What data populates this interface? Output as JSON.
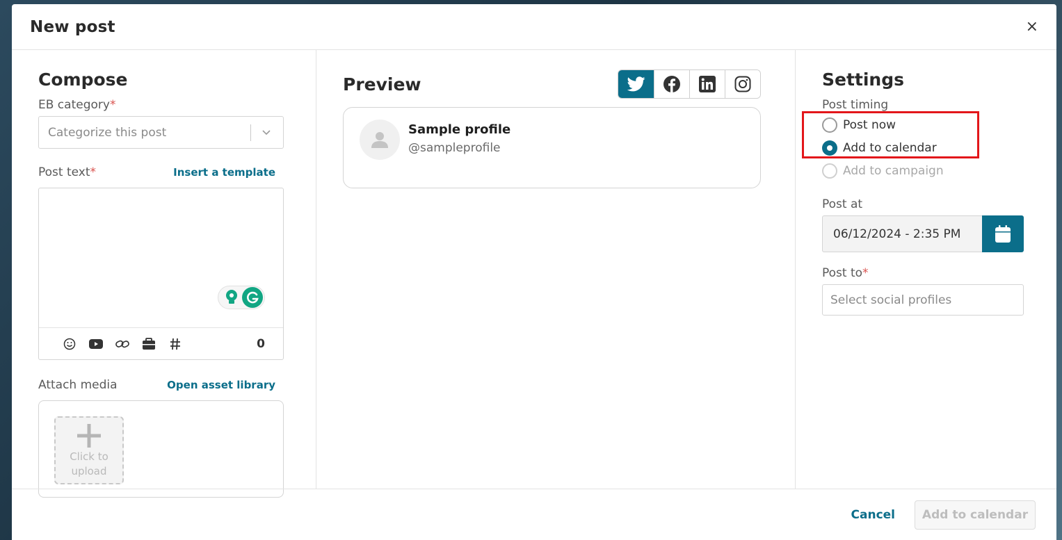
{
  "modal": {
    "title": "New post",
    "close_label": "×"
  },
  "compose": {
    "title": "Compose",
    "category_label": "EB category",
    "category_placeholder": "Categorize this post",
    "post_text_label": "Post text",
    "insert_template": "Insert a template",
    "char_count": "0",
    "toolbar_icons": [
      "emoji-icon",
      "youtube-icon",
      "link-icon",
      "briefcase-icon",
      "hashtag-icon"
    ],
    "attach_media_label": "Attach media",
    "open_asset_library": "Open asset library",
    "upload_line1": "Click to",
    "upload_line2": "upload"
  },
  "preview": {
    "title": "Preview",
    "networks": [
      {
        "name": "twitter",
        "active": true
      },
      {
        "name": "facebook",
        "active": false
      },
      {
        "name": "linkedin",
        "active": false
      },
      {
        "name": "instagram",
        "active": false
      }
    ],
    "profile_name": "Sample profile",
    "profile_handle": "@sampleprofile"
  },
  "settings": {
    "title": "Settings",
    "post_timing_label": "Post timing",
    "timing_options": [
      {
        "label": "Post now",
        "checked": false,
        "disabled": false
      },
      {
        "label": "Add to calendar",
        "checked": true,
        "disabled": false
      },
      {
        "label": "Add to campaign",
        "checked": false,
        "disabled": true
      }
    ],
    "post_at_label": "Post at",
    "post_at_value": "06/12/2024 - 2:35 PM",
    "post_to_label": "Post to",
    "post_to_placeholder": "Select social profiles"
  },
  "footer": {
    "cancel": "Cancel",
    "submit": "Add to calendar"
  },
  "colors": {
    "accent": "#0b6e8a",
    "required": "#d9534f",
    "highlight": "#e3161a"
  }
}
